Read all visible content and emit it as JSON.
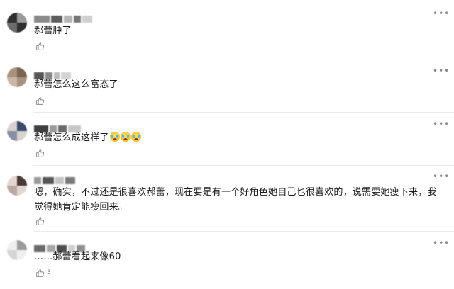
{
  "comments": [
    {
      "text": "郝蕾肿了",
      "emoji_count": 0,
      "like_count": "",
      "avatar_colors": [
        "#2f2f2f",
        "#6b6b6b",
        "#9a9a9a"
      ],
      "name_colors": [
        "#8a8a8a",
        "#5d5d5d",
        "#b5b5b5",
        "#777777",
        "#cfcfcf"
      ]
    },
    {
      "text": "郝蕾怎么这么富态了",
      "emoji_count": 0,
      "like_count": "",
      "avatar_colors": [
        "#7a6454",
        "#a8927e",
        "#c9b8a7"
      ],
      "name_colors": [
        "#555555",
        "#888888",
        "#bbbbbb",
        "#d4d4d4"
      ]
    },
    {
      "text": "郝蕾怎么成这样了",
      "emoji_count": 3,
      "like_count": "",
      "avatar_colors": [
        "#3a4a6a",
        "#8a8fa8",
        "#d7d2cf"
      ],
      "name_colors": [
        "#3f3f3f",
        "#9a9a9a",
        "#6a6a6a",
        "#c8c8c8"
      ]
    },
    {
      "text": "嗯，确实，不过还是很喜欢郝蕾，现在要是有一个好角色她自己也很喜欢的，说需要她瘦下来，我觉得她肯定能瘦回来。",
      "emoji_count": 0,
      "like_count": "",
      "avatar_colors": [
        "#4a3a3a",
        "#b9a9a4",
        "#e3d6d0"
      ],
      "name_colors": [
        "#9a9a9a",
        "#555555",
        "#c4c4c4",
        "#7a7a7a"
      ]
    },
    {
      "text": "……郝蕾看起来像60",
      "emoji_count": 0,
      "like_count": "3",
      "avatar_colors": [
        "#d6d6d6",
        "#9c9c9c",
        "#efefef"
      ],
      "name_colors": [
        "#6a6a6a",
        "#a5a5a5",
        "#4e4e4e",
        "#cfcfcf",
        "#8f8f8f"
      ]
    }
  ],
  "icons": {
    "more": "more-dots-icon",
    "like": "thumbs-up-icon",
    "emoji": "crying-laughing-emoji-icon"
  },
  "colors": {
    "divider": "#ececec",
    "icon_gray": "#8a8a8a"
  }
}
